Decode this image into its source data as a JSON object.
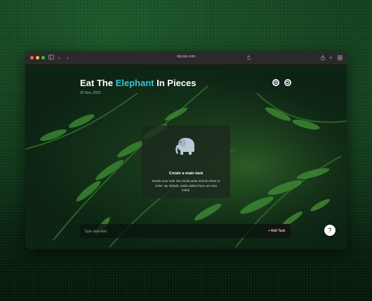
{
  "browser": {
    "url": "cipcoio.com",
    "icons": {
      "sidebar": "sidebar-icon",
      "back": "chevron-left-icon",
      "forward": "chevron-right-icon",
      "reload": "reload-icon",
      "share": "share-icon",
      "new_tab": "plus-icon",
      "tabs": "tabs-grid-icon"
    }
  },
  "header": {
    "title_before": "Eat The",
    "title_accent": "Elephant",
    "title_after": "In Pieces",
    "date": "20 Nov, 2023",
    "accent_color": "#35c3d8"
  },
  "actions": {
    "settings_icon": "gear-icon",
    "theme_icon": "palette-icon"
  },
  "empty_state": {
    "icon": "elephant-icon",
    "title": "Create a main task",
    "description": "Divide your task into small parts and do them in order. By default, tasks added here are due today."
  },
  "task_input": {
    "placeholder": "Type new task",
    "value": "",
    "add_label": "+ Add Task"
  },
  "help": {
    "label": "?"
  }
}
